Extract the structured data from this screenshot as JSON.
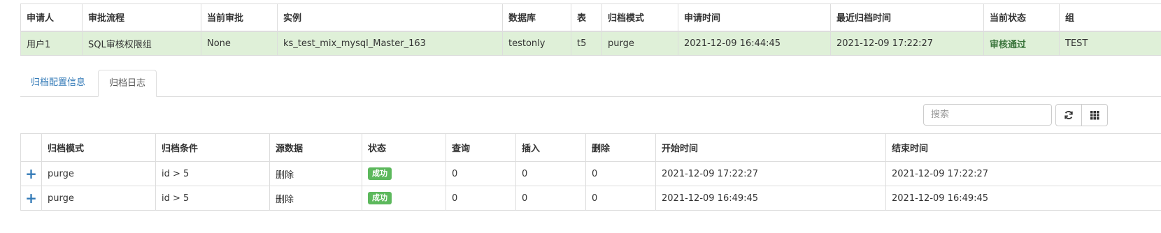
{
  "info_table": {
    "headers": [
      "申请人",
      "审批流程",
      "当前审批",
      "实例",
      "数据库",
      "表",
      "归档模式",
      "申请时间",
      "最近归档时间",
      "当前状态",
      "组"
    ],
    "row": {
      "applicant": "用户1",
      "workflow": "SQL审核权限组",
      "current_approval": "None",
      "instance": "ks_test_mix_mysql_Master_163",
      "database": "testonly",
      "table": "t5",
      "archive_mode": "purge",
      "apply_time": "2021-12-09 16:44:45",
      "last_archive_time": "2021-12-09 17:22:27",
      "status": "审核通过",
      "group": "TEST"
    },
    "status_color": "#3c763d",
    "row_bg": "#dff0d8"
  },
  "tabs": [
    {
      "label": "归档配置信息",
      "active": false
    },
    {
      "label": "归档日志",
      "active": true
    }
  ],
  "toolbar": {
    "search_placeholder": "搜索",
    "refresh_icon": "refresh-icon",
    "columns_icon": "grid-columns-icon"
  },
  "log_table": {
    "headers": [
      "归档模式",
      "归档条件",
      "源数据",
      "状态",
      "查询",
      "插入",
      "删除",
      "开始时间",
      "结束时间"
    ],
    "rows": [
      {
        "mode": "purge",
        "condition": "id > 5",
        "source": "删除",
        "status": "成功",
        "select": "0",
        "insert": "0",
        "delete": "0",
        "start": "2021-12-09 17:22:27",
        "end": "2021-12-09 17:22:27"
      },
      {
        "mode": "purge",
        "condition": "id > 5",
        "source": "删除",
        "status": "成功",
        "select": "0",
        "insert": "0",
        "delete": "0",
        "start": "2021-12-09 16:49:45",
        "end": "2021-12-09 16:49:45"
      }
    ],
    "badge_color": "#5cb85c",
    "expand_icon": "plus-icon"
  }
}
